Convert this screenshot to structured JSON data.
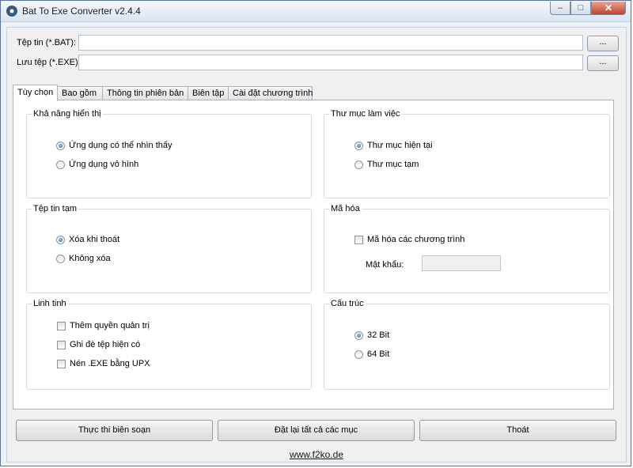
{
  "window": {
    "title": "Bat To Exe Converter v2.4.4",
    "minimize": "–",
    "maximize": "□",
    "close": "✕"
  },
  "files": {
    "input_label": "Tệp tin (*.BAT):",
    "input_value": "",
    "output_label": "Lưu tệp (*.EXE):",
    "output_value": "",
    "browse_label": "..."
  },
  "tabs": [
    "Tùy chọn",
    "Bao gồm",
    "Thông tin phiên bản",
    "Biên tập",
    "Cài đặt chương trình"
  ],
  "visibility": {
    "title": "Khả năng hiển thị",
    "options": [
      "Ứng dụng có thể nhìn thấy",
      "Ứng dụng vô hình"
    ],
    "selected": 0
  },
  "workdir": {
    "title": "Thư mục làm việc",
    "options": [
      "Thư mục hiện tại",
      "Thư mục tạm"
    ],
    "selected": 0
  },
  "tempfiles": {
    "title": "Tệp tin tạm",
    "options": [
      "Xóa khi thoát",
      "Không xóa"
    ],
    "selected": 0
  },
  "encryption": {
    "title": "Mã hóa",
    "checkbox": "Mã hóa các chương trình",
    "checked": false,
    "password_label": "Mật khẩu:",
    "password_value": ""
  },
  "misc": {
    "title": "Linh tinh",
    "options": [
      "Thêm quyền quản trị",
      "Ghi đè tệp hiện có",
      "Nén .EXE bằng UPX"
    ]
  },
  "arch": {
    "title": "Cấu trúc",
    "options": [
      "32 Bit",
      "64 Bit"
    ],
    "selected": 0
  },
  "buttons": {
    "compile": "Thực thi biên soạn",
    "reset": "Đặt lại tất cả các mục",
    "exit": "Thoát"
  },
  "footer": {
    "link": "www.f2ko.de"
  }
}
